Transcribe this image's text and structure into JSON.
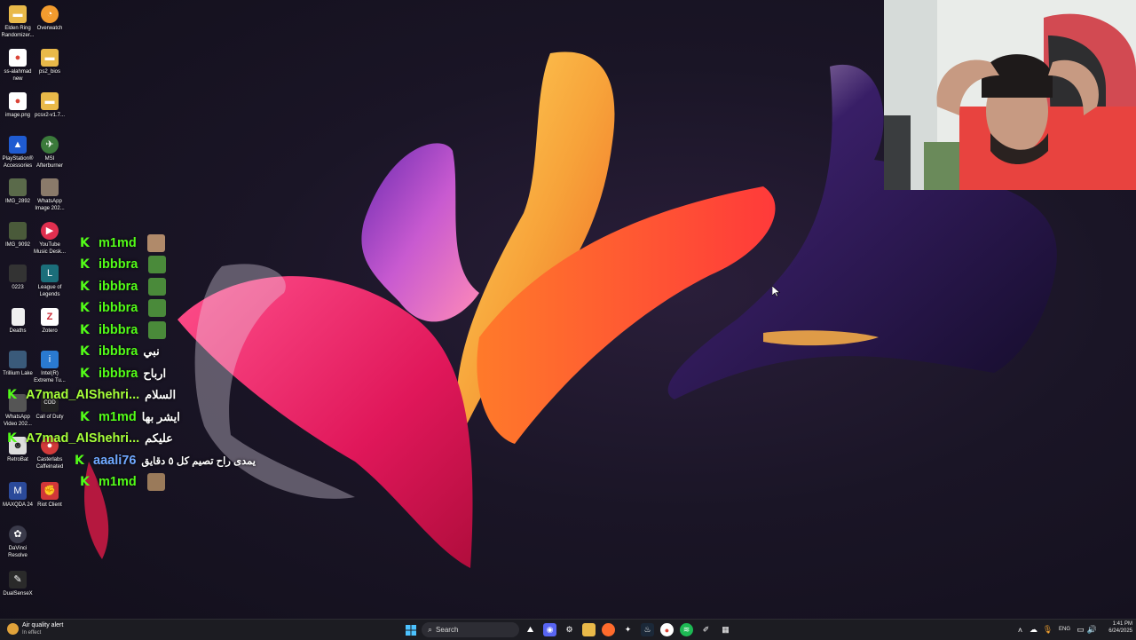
{
  "desktop_icons": [
    {
      "label": "Elden Ring Randomizer...",
      "icon": "folder-icon",
      "color": "#e9b949"
    },
    {
      "label": "Overwatch",
      "icon": "overwatch-icon",
      "color": "#f29b2e"
    },
    {
      "label": "ss-alahmad new",
      "icon": "chrome-icon",
      "color": "#4285f4"
    },
    {
      "label": "ps2_bios",
      "icon": "folder-icon",
      "color": "#e9b949"
    },
    {
      "label": "image.png",
      "icon": "chrome-icon",
      "color": "#4285f4"
    },
    {
      "label": "pcsx2-v1.7...",
      "icon": "folder-icon",
      "color": "#e9b949"
    },
    {
      "label": "PlayStation® Accessories",
      "icon": "playstation-icon",
      "color": "#1f5bd1"
    },
    {
      "label": "MSI Afterburner",
      "icon": "msi-icon",
      "color": "#3b7a3b"
    },
    {
      "label": "IMG_2892",
      "icon": "image-icon",
      "color": "#5a6a4a"
    },
    {
      "label": "WhatsApp Image 202...",
      "icon": "image-icon",
      "color": "#8a7a6a"
    },
    {
      "label": "IMG_9092",
      "icon": "image-icon",
      "color": "#4a5a3a"
    },
    {
      "label": "YouTube Music Desk...",
      "icon": "youtube-music-icon",
      "color": "#e02f4f"
    },
    {
      "label": "0223",
      "icon": "video-icon",
      "color": "#333333"
    },
    {
      "label": "League of Legends",
      "icon": "league-icon",
      "color": "#1b6e7a"
    },
    {
      "label": "Deaths",
      "icon": "document-icon",
      "color": "#f0f0f0"
    },
    {
      "label": "Zotero",
      "icon": "zotero-icon",
      "color": "#cc2936"
    },
    {
      "label": "Trillium Lake",
      "icon": "image-icon",
      "color": "#3a5a7a"
    },
    {
      "label": "Intel(R) Extreme Tu...",
      "icon": "intel-icon",
      "color": "#2a7ad1"
    },
    {
      "label": "WhatsApp Video 202...",
      "icon": "video-icon",
      "color": "#555555"
    },
    {
      "label": "Call of Duty",
      "icon": "cod-icon",
      "color": "#222222"
    },
    {
      "label": "RetroBat",
      "icon": "retrobat-icon",
      "color": "#dddddd"
    },
    {
      "label": "Casterlabs Caffeinated",
      "icon": "casterlabs-icon",
      "color": "#d23a3a"
    },
    {
      "label": "MAXQDA 24",
      "icon": "maxqda-icon",
      "color": "#2b4a9a"
    },
    {
      "label": "Riot Client",
      "icon": "riot-icon",
      "color": "#d13639"
    },
    {
      "label": "DaVinci Resolve",
      "icon": "davinci-icon",
      "color": "#3a3a4a"
    },
    {
      "label": "DualSenseX",
      "icon": "dualsense-icon",
      "color": "#2a2a2a"
    }
  ],
  "chat": [
    {
      "user": "m1md",
      "message": "",
      "style": "green",
      "avatar": "#b08a6a"
    },
    {
      "user": "ibbbra",
      "message": "",
      "style": "green",
      "avatar": "#4a8a3a"
    },
    {
      "user": "ibbbra",
      "message": "",
      "style": "green",
      "avatar": "#4a8a3a"
    },
    {
      "user": "ibbbra",
      "message": "",
      "style": "green",
      "avatar": "#4a8a3a"
    },
    {
      "user": "ibbbra",
      "message": "",
      "style": "green",
      "avatar": "#4a8a3a"
    },
    {
      "user": "ibbbra",
      "message": "نبي",
      "style": "green",
      "avatar": ""
    },
    {
      "user": "ibbbra",
      "message": "ارباح",
      "style": "green",
      "avatar": ""
    },
    {
      "user": "A7mad_AlShehri...",
      "message": "السلام",
      "style": "lime",
      "avatar": ""
    },
    {
      "user": "m1md",
      "message": "ايشر بها",
      "style": "green",
      "avatar": ""
    },
    {
      "user": "A7mad_AlShehri...",
      "message": "عليكم",
      "style": "lime",
      "avatar": ""
    },
    {
      "user": "aaali76",
      "message": "يمدى راح تصيم كل ٥ دقايق",
      "style": "blue",
      "avatar": ""
    },
    {
      "user": "m1md",
      "message": "",
      "style": "green",
      "avatar": "#9a7a5a"
    }
  ],
  "kick_glyph": "K",
  "taskbar": {
    "alert_title": "Air quality alert",
    "alert_sub": "In effect",
    "search_placeholder": "Search",
    "language": "ENG",
    "time": "1:41 PM",
    "date": "6/24/2025"
  },
  "colors": {
    "kick_green": "#53fc18",
    "taskbar": "#1c1c22"
  }
}
